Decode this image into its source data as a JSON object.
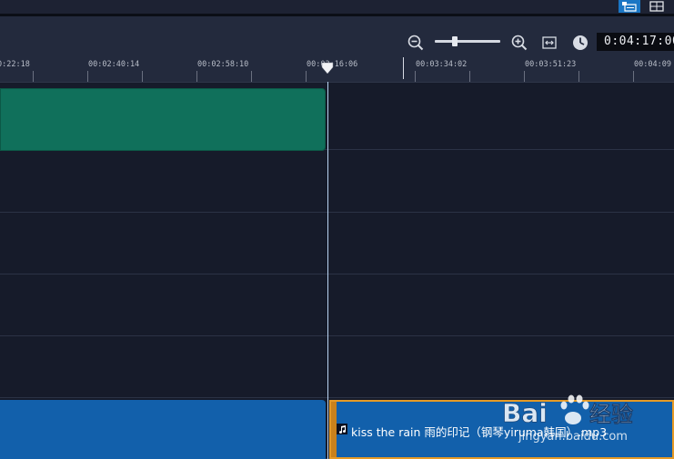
{
  "window": {
    "view_buttons": [
      "storyboard-view",
      "timeline-view"
    ]
  },
  "toolbar": {
    "zoom_out_icon": "zoom-out-icon",
    "zoom_in_icon": "zoom-in-icon",
    "fit_icon": "fit-to-window-icon",
    "clock_icon": "clock-icon",
    "zoom_level": 0.3,
    "timecode": "0:04:17:00"
  },
  "ruler": {
    "labels": [
      "0:22:18",
      "00:02:40:14",
      "00:02:58:10",
      "00:03:16:06",
      "00:03:34:02",
      "00:03:51:23",
      "00:04:09"
    ]
  },
  "tracks": {
    "audio_clip": {
      "icon": "music-note-icon",
      "title": "kiss the rain 雨的印记（钢琴yiruma韩国）.mp3"
    }
  },
  "watermark": {
    "brand": "Bai",
    "brand_suffix": "经验",
    "url": "jingyan.baidu.com"
  },
  "colors": {
    "video_clip": "#10705b",
    "audio_clip": "#1260ab",
    "selection": "#e59a26",
    "accent": "#1a76c4"
  }
}
